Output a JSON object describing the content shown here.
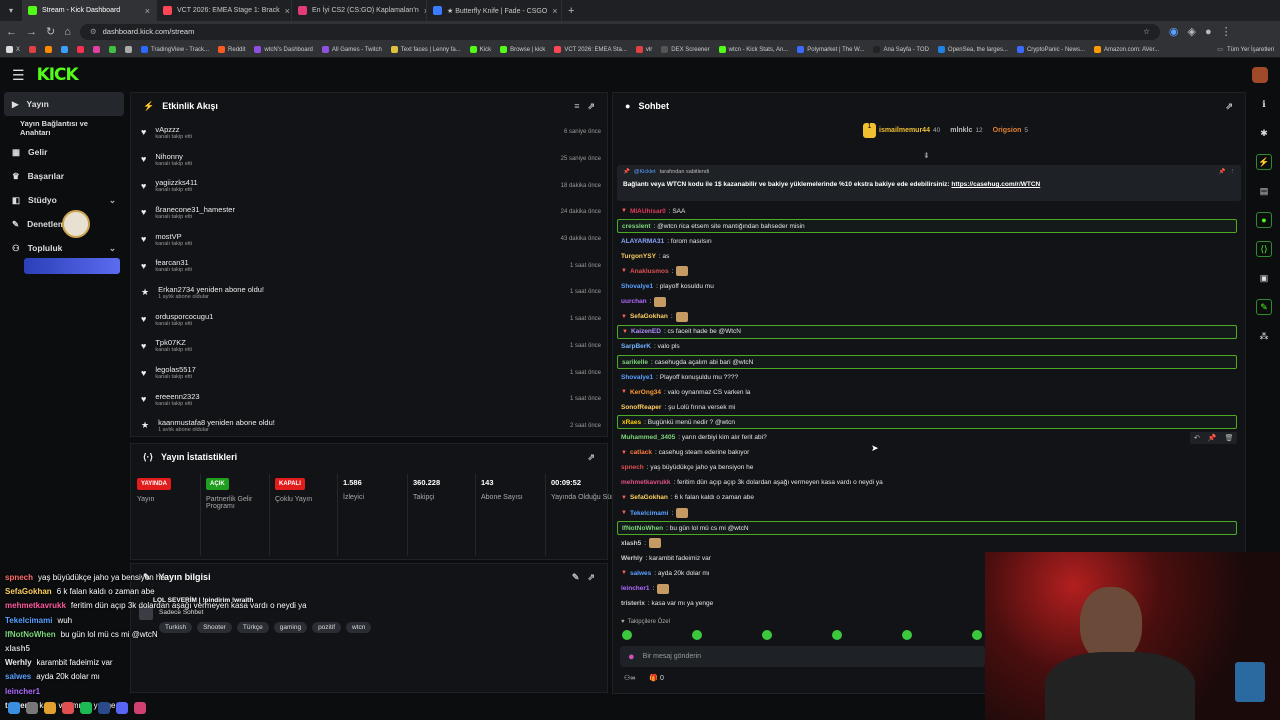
{
  "tabs": [
    {
      "title": "Stream - Kick Dashboard",
      "active": true,
      "color": "#53fc18"
    },
    {
      "title": "VCT 2026: EMEA Stage 1: Brack",
      "active": false,
      "color": "#ff4655"
    },
    {
      "title": "En İyi CS2 (CS:GO) Kaplamaları'n",
      "active": false,
      "color": "#e33b78"
    },
    {
      "title": "★ Butterfly Knife | Fade - CSGO",
      "active": false,
      "color": "#3b7bff"
    }
  ],
  "address": {
    "url": "dashboard.kick.com/stream"
  },
  "bookmarks": [
    "X",
    "",
    "",
    "",
    "",
    "",
    "",
    "",
    "TradingView - Track...",
    "Reddit",
    "wtcN's Dashboard",
    "All Games - Twitch",
    "Text faces | Lenny fa...",
    "Kick",
    "Browse | kick",
    "VCT 2026: EMEA Sta...",
    "vlr",
    "DEX Screener",
    "wtcn - Kick Stats, An...",
    "Polymarket | The W...",
    "Ana Sayfa - TOD",
    "OpenSea, the larges...",
    "CryptoPanic - News...",
    "Amazon.com: AVer..."
  ],
  "bookmarks_all": "Tüm Yer İşaretleri",
  "kick": {
    "logo": "KICK"
  },
  "sidebar": {
    "items": [
      {
        "label": "Yayın",
        "icon": "stream-icon",
        "selected": true
      },
      {
        "label": "Yayın Bağlantısı ve Anahtarı",
        "icon": "",
        "selected": false
      },
      {
        "label": "Gelir",
        "icon": "wallet-icon",
        "selected": false
      },
      {
        "label": "Başarılar",
        "icon": "trophy-icon",
        "selected": false
      },
      {
        "label": "Stüdyo",
        "icon": "studio-icon",
        "selected": false
      },
      {
        "label": "Denetleme",
        "icon": "shield-icon",
        "selected": false
      },
      {
        "label": "Topluluk",
        "icon": "community-icon",
        "selected": false
      }
    ]
  },
  "activity": {
    "title": "Etkinlik Akışı",
    "items": [
      {
        "name": "vApzzz",
        "sub": "kanalı takip etti",
        "time": "6 saniye önce"
      },
      {
        "name": "Nihonny",
        "sub": "kanalı takip etti",
        "time": "25 saniye önce"
      },
      {
        "name": "yagiizzks411",
        "sub": "kanalı takip etti",
        "time": "18 dakika önce"
      },
      {
        "name": "ßranecone31_hamester",
        "sub": "kanalı takip etti",
        "time": "24 dakika önce"
      },
      {
        "name": "mostVP",
        "sub": "kanalı takip etti",
        "time": "43 dakika önce"
      },
      {
        "name": "fearcan31",
        "sub": "kanalı takip etti",
        "time": "1 saat önce"
      },
      {
        "name": "Erkan2734 yeniden abone oldu!",
        "sub": "1 aylık abone oldular",
        "time": "1 saat önce"
      },
      {
        "name": "ordusporcocugu1",
        "sub": "kanalı takip etti",
        "time": "1 saat önce"
      },
      {
        "name": "Tpk07KZ",
        "sub": "kanalı takip etti",
        "time": "1 saat önce"
      },
      {
        "name": "legolas5517",
        "sub": "kanalı takip etti",
        "time": "1 saat önce"
      },
      {
        "name": "ereeenn2323",
        "sub": "kanalı takip etti",
        "time": "1 saat önce"
      },
      {
        "name": "kaanmustafa8 yeniden abone oldu!",
        "sub": "1 aylık abone oldular",
        "time": "2 saat önce"
      }
    ]
  },
  "stats": {
    "title": "Yayın İstatistikleri",
    "cols": [
      {
        "badge": "YAYINDA",
        "badge_color": "#e21b1b",
        "label": "Yayın"
      },
      {
        "badge": "AÇIK",
        "badge_color": "#1f9e1f",
        "label": "Partnerlik Gelir Programı"
      },
      {
        "badge": "KAPALI",
        "badge_color": "#e21b1b",
        "label": "Çoklu Yayın"
      },
      {
        "value": "1.586",
        "label": "İzleyici"
      },
      {
        "value": "360.228",
        "label": "Takipçi"
      },
      {
        "value": "143",
        "label": "Abone Sayısı"
      },
      {
        "value": "00:09:52",
        "label": "Yayında Olduğu Süre"
      }
    ]
  },
  "info": {
    "title": "Yayın bilgisi",
    "stream_title": "LOL SEVERİM | !pindirim !wraith",
    "category": "Sadece Sohbet",
    "tags": [
      "Turkish",
      "Shooter",
      "Türkçe",
      "gaming",
      "pozitif",
      "wtcn"
    ]
  },
  "chat": {
    "title": "Sohbet",
    "leaders": [
      {
        "name": "ismailmemur44",
        "count": "40"
      },
      {
        "name": "mlnklc",
        "count": "12"
      },
      {
        "name": "Origsion",
        "count": "5"
      }
    ],
    "pinned_by": "@Kicklet",
    "pinned_by_suffix": "tarafından sabitlendi",
    "pinned_text": "Bağlantı veya WTCN kodu ile 1$ kazanabilir ve bakiye yüklemelerinde %10 ekstra bakiye ede edebilirsiniz:",
    "pinned_link": "https://casehug.com/r/WTCN",
    "messages": [
      {
        "user": "MIAUhisar0",
        "text": ": SAA",
        "color": "#e0385b",
        "hl": false
      },
      {
        "user": "cresslent",
        "text": ": @wtcn rica etsem site mantığından bahseder misin",
        "color": "#7cd67a",
        "hl": true
      },
      {
        "user": "ALAYARMA31",
        "text": ": forom nasılsın",
        "color": "#8aa6ff",
        "hl": false
      },
      {
        "user": "TurgonYSY",
        "text": ": as",
        "color": "#ffd060",
        "hl": false
      },
      {
        "user": "Anaklusmos",
        "text": ":",
        "color": "#e05050",
        "hl": false,
        "emote": true
      },
      {
        "user": "Shovalye1",
        "text": ": playoff kosuldu mu",
        "color": "#5aa0ff",
        "hl": false
      },
      {
        "user": "uurchan",
        "text": ":",
        "color": "#b06aff",
        "hl": false,
        "emote": true
      },
      {
        "user": "SefaGokhan",
        "text": ":",
        "color": "#ffd060",
        "hl": false,
        "emote": true
      },
      {
        "user": "KaizenED",
        "text": ": cs faceit hade be @WtcN",
        "color": "#b08cff",
        "hl": true
      },
      {
        "user": "SarpBerK",
        "text": ": valo pls",
        "color": "#6fb5ff",
        "hl": false
      },
      {
        "user": "sarikelle",
        "text": ": casehugda açalım abi bari @wtcN",
        "color": "#7cd67a",
        "hl": true
      },
      {
        "user": "Shovalye1",
        "text": ": Playoff konuşuldu mu ????",
        "color": "#5aa0ff",
        "hl": false
      },
      {
        "user": "KerOng34",
        "text": ": valo oynanmaz CS varken la",
        "color": "#ff9a30",
        "hl": false
      },
      {
        "user": "SonofReaper",
        "text": ": şu Lolü fırına versek mi",
        "color": "#ffd060",
        "hl": false
      },
      {
        "user": "xRaes",
        "text": ": Bugünkü menü nedir ? @wtcn",
        "color": "#ffcc00",
        "hl": true
      },
      {
        "user": "Muhammed_3405",
        "text": ": yarın derbiyi kim alır ferit abi?",
        "color": "#7cd67a",
        "hl": false
      },
      {
        "user": "catlack",
        "text": ": casehug steam ederine bakıyor",
        "color": "#ff7a3d",
        "hl": false
      },
      {
        "user": "spnech",
        "text": ": yaş büyüdükçe jaho ya bensiyon he",
        "color": "#e05050",
        "hl": false
      },
      {
        "user": "mehmetkavrukk",
        "text": ": feritim dün açıp açıp 3k dolardan aşağı vermeyen kasa vardı o neydi ya",
        "color": "#e0508a",
        "hl": false
      },
      {
        "user": "SefaGokhan",
        "text": ": 6 k falan kaldı o zaman abe",
        "color": "#ffd060",
        "hl": false
      },
      {
        "user": "Tekelcimami",
        "text": ":",
        "color": "#5aa0ff",
        "hl": false,
        "emote": true
      },
      {
        "user": "IfNotNoWhen",
        "text": ": bu gün lol mü cs mi @wtcN",
        "color": "#7cd67a",
        "hl": true
      },
      {
        "user": "xlash5",
        "text": ":",
        "color": "#cccccc",
        "hl": false,
        "emote": true
      },
      {
        "user": "Werhly",
        "text": ": karambit fadeimiz var",
        "color": "#cccccc",
        "hl": false
      },
      {
        "user": "salwes",
        "text": ": ayda 20k dolar mı",
        "color": "#5aa0ff",
        "hl": false
      },
      {
        "user": "leincher1",
        "text": ":",
        "color": "#b06aff",
        "hl": false,
        "emote": true
      },
      {
        "user": "tristerix",
        "text": ": kasa var mı ya yenge",
        "color": "#cccccc",
        "hl": false
      }
    ],
    "followers_only": "Takipçilere Özel",
    "input_placeholder": "Bir mesaj gönderin",
    "footer_count": "0"
  },
  "overlay_chat": [
    {
      "user": "spnech",
      "text": "yaş büyüdükçe jaho ya bensiyon he",
      "color": "#ff6b6b"
    },
    {
      "user": "SefaGokhan",
      "text": "6 k falan kaldı o zaman abe",
      "color": "#ffd060"
    },
    {
      "user": "mehmetkavrukk",
      "text": "feritim dün açıp 3k dolardan aşağı vermeyen kasa vardı o neydi ya",
      "color": "#ff5aa0"
    },
    {
      "user": "Tekelcimami",
      "text": "wuh",
      "color": "#5aa0ff"
    },
    {
      "user": "IfNotNoWhen",
      "text": "bu gün lol mü cs mi @wtcN",
      "color": "#7cd67a"
    },
    {
      "user": "xlash5",
      "text": "",
      "color": "#cccccc"
    },
    {
      "user": "Werhly",
      "text": "karambit fadeimiz var",
      "color": "#eeeeee"
    },
    {
      "user": "salwes",
      "text": "ayda 20k dolar mı",
      "color": "#5aa0ff"
    },
    {
      "user": "leincher1",
      "text": "",
      "color": "#b06aff"
    },
    {
      "user": "tristerix",
      "text": "kasa var mı ya yenge",
      "color": "#eeeeee"
    }
  ]
}
